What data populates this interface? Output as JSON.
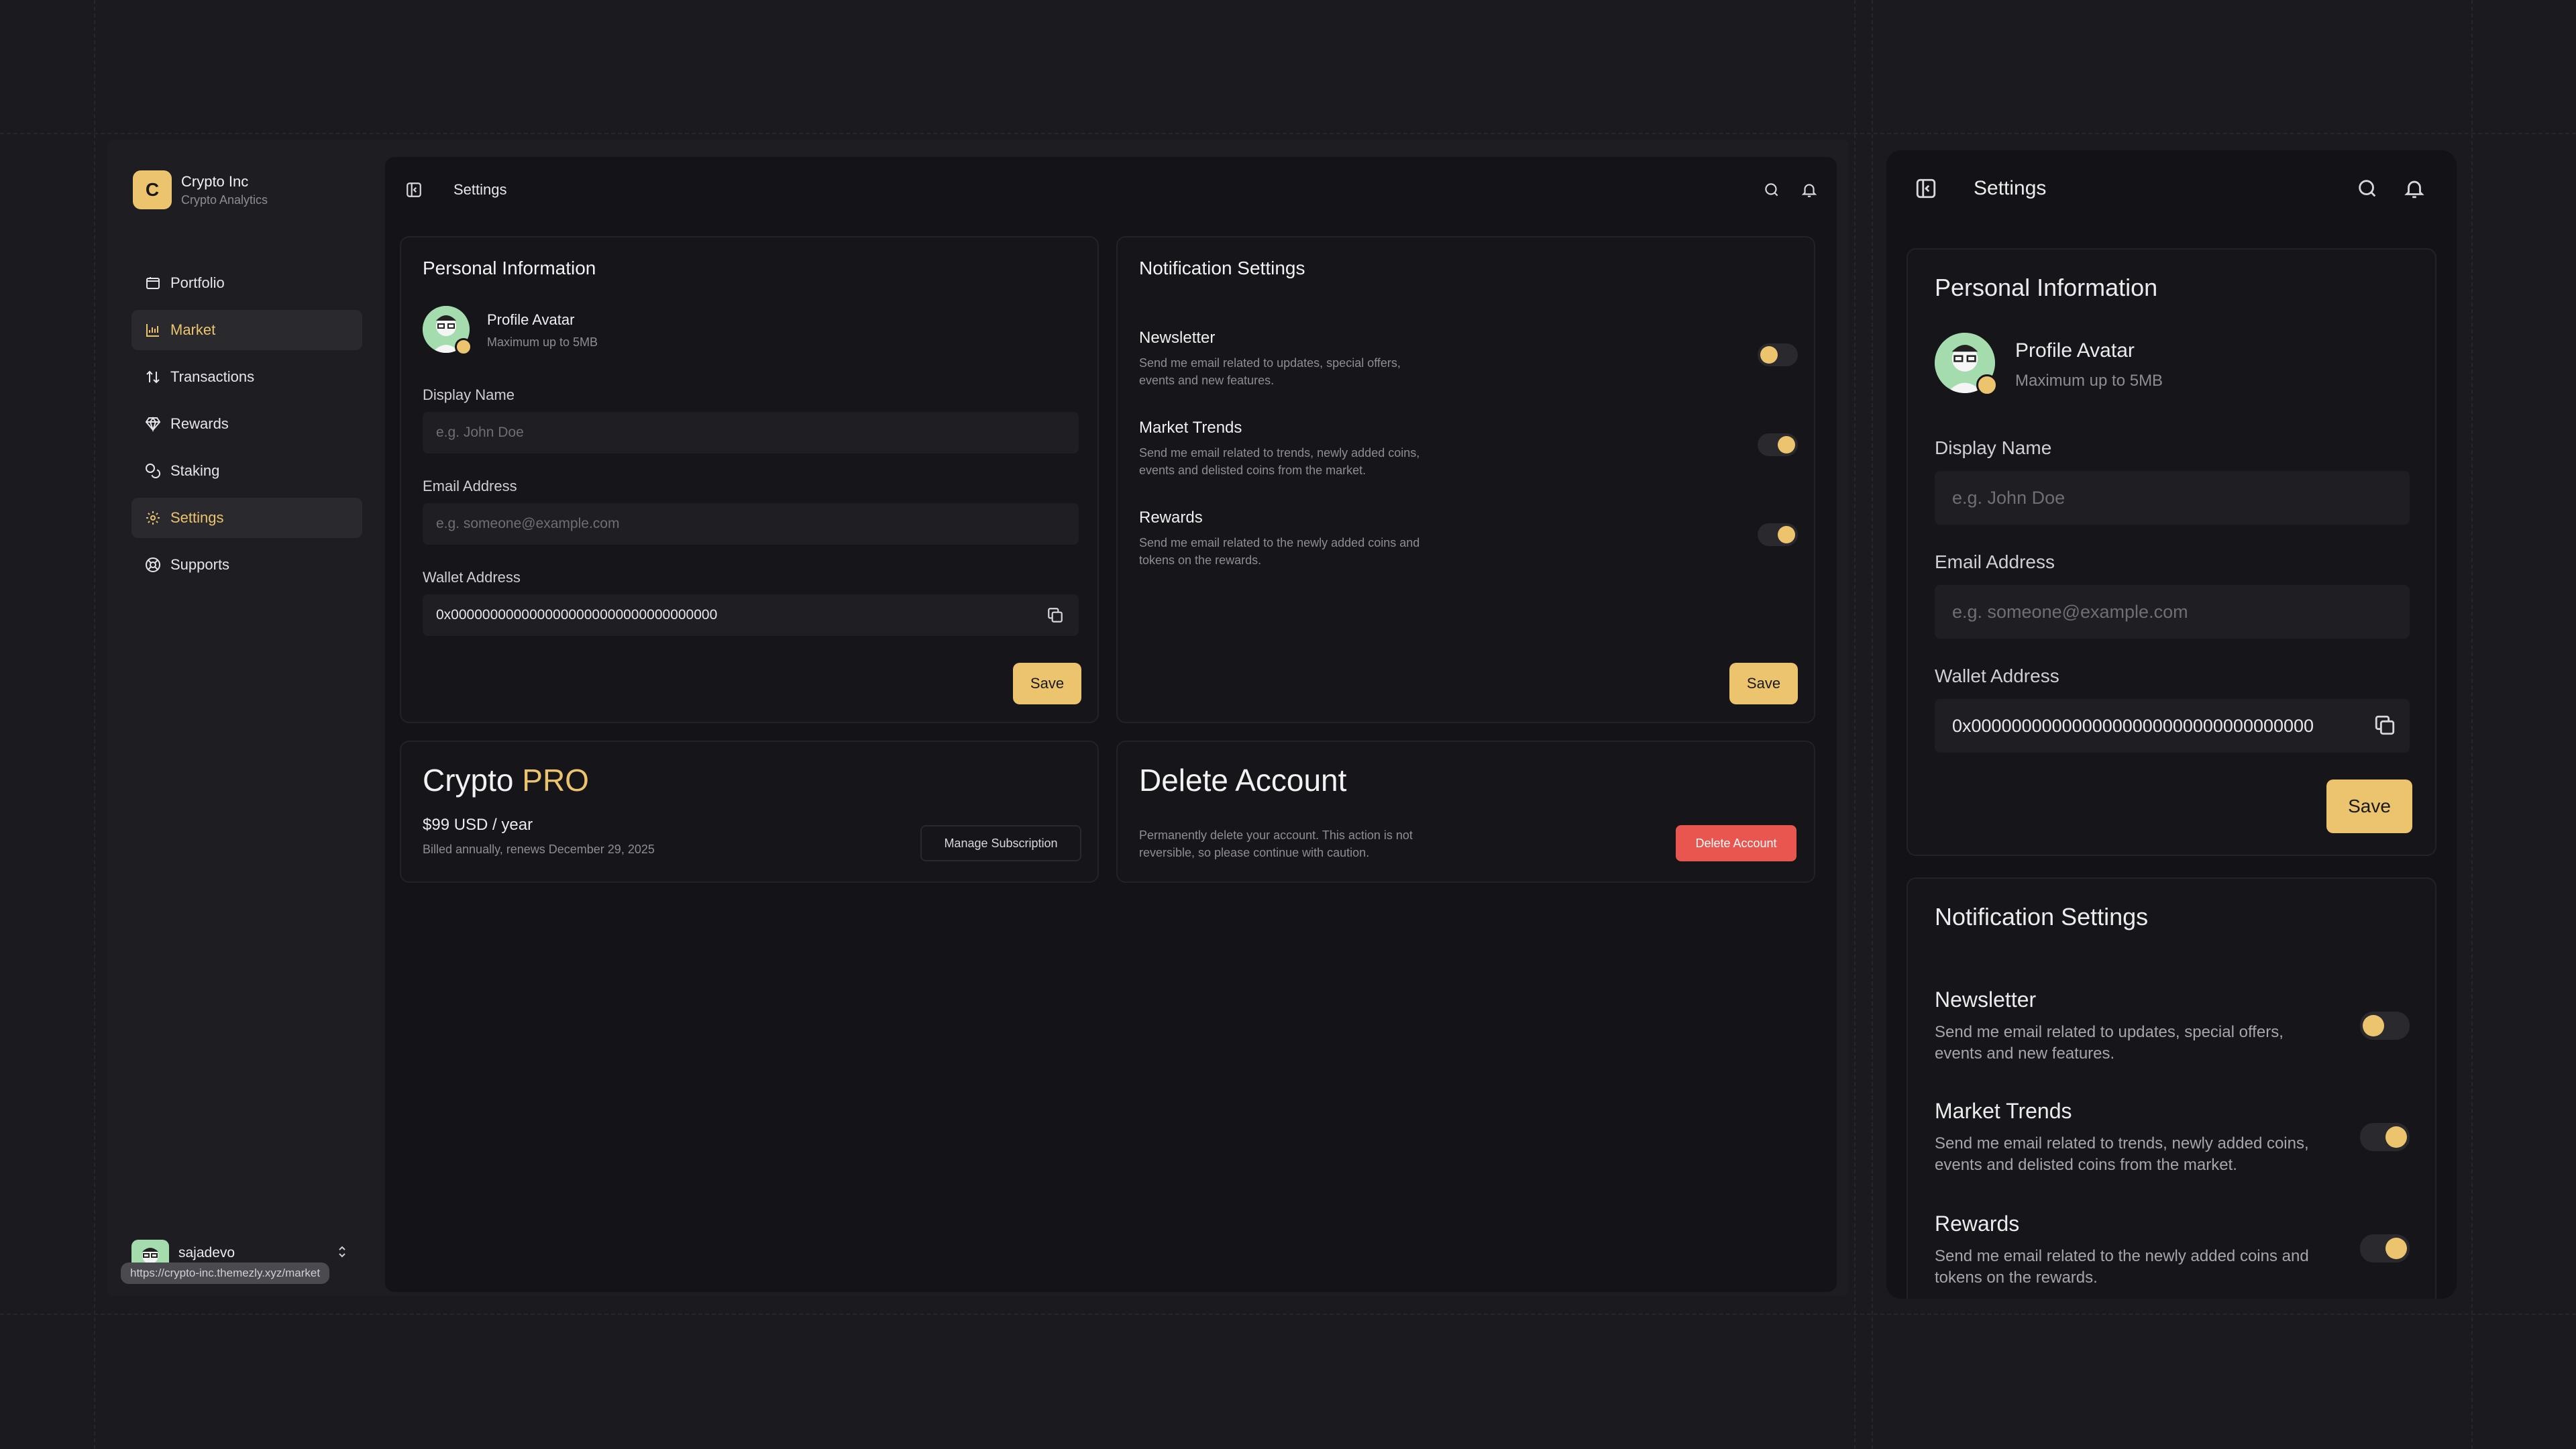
{
  "brand": {
    "logo_letter": "C",
    "name": "Crypto Inc",
    "subtitle": "Crypto Analytics"
  },
  "sidebar": {
    "items": [
      {
        "label": "Portfolio",
        "icon": "portfolio-icon"
      },
      {
        "label": "Market",
        "icon": "chart-icon",
        "active": true
      },
      {
        "label": "Transactions",
        "icon": "arrows-icon"
      },
      {
        "label": "Rewards",
        "icon": "gem-icon"
      },
      {
        "label": "Staking",
        "icon": "coins-icon"
      },
      {
        "label": "Settings",
        "icon": "gear-icon",
        "active": true
      },
      {
        "label": "Supports",
        "icon": "lifebuoy-icon"
      }
    ]
  },
  "user": {
    "name": "sajadevo"
  },
  "status_url": "https://crypto-inc.themezly.xyz/market",
  "header": {
    "title": "Settings"
  },
  "personal": {
    "title": "Personal Information",
    "avatar_title": "Profile Avatar",
    "avatar_hint": "Maximum up to 5MB",
    "display_name_label": "Display Name",
    "display_name_placeholder": "e.g. John Doe",
    "email_label": "Email Address",
    "email_placeholder": "e.g. someone@example.com",
    "wallet_label": "Wallet Address",
    "wallet_value": "0x0000000000000000000000000000000000",
    "save_label": "Save"
  },
  "notifications": {
    "title": "Notification Settings",
    "items": [
      {
        "title": "Newsletter",
        "line1": "Send me email related to updates, special offers,",
        "line2": "events and new features.",
        "enabled": false
      },
      {
        "title": "Market Trends",
        "line1": "Send me email related to trends, newly added coins,",
        "line2": "events and delisted coins from the market.",
        "enabled": true
      },
      {
        "title": "Rewards",
        "line1": "Send me email related to the newly added coins and",
        "line2": "tokens on the rewards.",
        "enabled": true
      }
    ],
    "save_label": "Save"
  },
  "pro": {
    "title": "Crypto",
    "title_accent": "PRO",
    "price": "$99 USD / year",
    "billing": "Billed annually, renews December 29, 2025",
    "manage_label": "Manage Subscription"
  },
  "delete": {
    "title": "Delete Account",
    "line1": "Permanently delete your account. This action is not",
    "line2": "reversible, so please continue with caution.",
    "button_label": "Delete Account"
  },
  "colors": {
    "accent": "#ecc46e",
    "danger": "#e8564f",
    "bg": "#1b1a1f",
    "panel": "#141317"
  }
}
